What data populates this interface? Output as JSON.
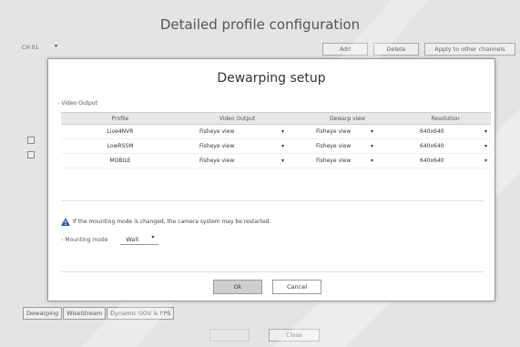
{
  "background": {
    "title": "Detailed profile configuration",
    "channel": "CH 01",
    "add_label": "Add",
    "delete_label": "Delete",
    "apply_label": "Apply to other channels",
    "tabs": [
      "Dewarping",
      "WiseStream",
      "Dynamic GOV & FPS"
    ],
    "close_label": "Close"
  },
  "dialog": {
    "title": "Dewarping setup",
    "section_video_output": "Video Output",
    "columns": [
      "Profile",
      "Video Output",
      "Dewarp view",
      "Resolution"
    ],
    "rows": [
      {
        "profile": "Live4NVR",
        "video_output": "Fisheye view",
        "dewarp_view": "Fisheye view",
        "resolution": "640x640"
      },
      {
        "profile": "LowRSSM",
        "video_output": "Fisheye view",
        "dewarp_view": "Fisheye view",
        "resolution": "640x640"
      },
      {
        "profile": "MOBILE",
        "video_output": "Fisheye view",
        "dewarp_view": "Fisheye view",
        "resolution": "640x640"
      }
    ],
    "warning": "If the mounting mode is changed, the camera system may be restarted.",
    "mounting_mode_label": "Mounting mode",
    "mounting_mode_value": "Wall",
    "ok_label": "Ok",
    "cancel_label": "Cancel"
  },
  "colors": {
    "accent_orange": "#e07b39",
    "warning_blue": "#2a5db0"
  }
}
